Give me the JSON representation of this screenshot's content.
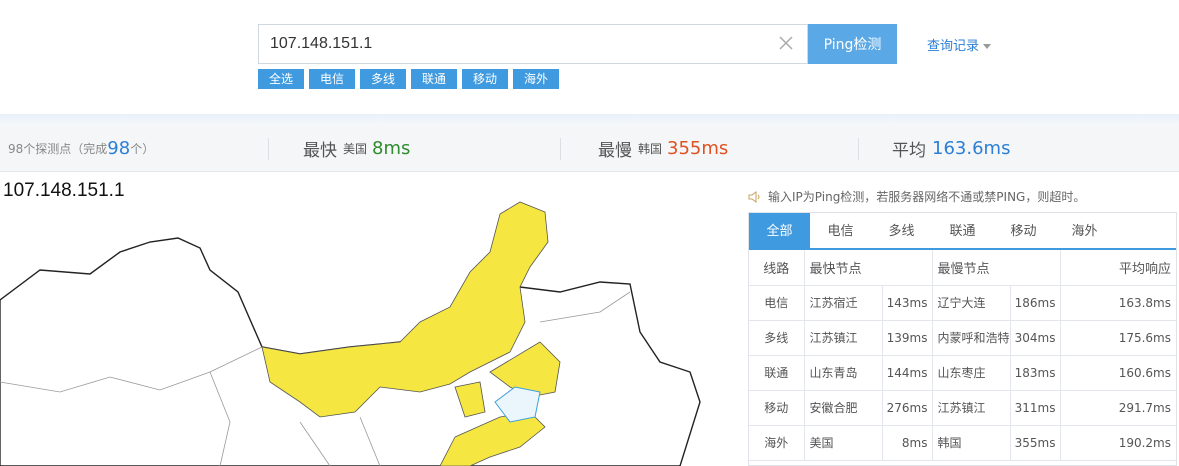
{
  "search": {
    "value": "107.148.151.1",
    "button_label": "Ping检测",
    "history_label": "查询记录",
    "filters": [
      "全选",
      "电信",
      "多线",
      "联通",
      "移动",
      "海外"
    ]
  },
  "stats": {
    "count_prefix": "98个探测点（完成",
    "count_value": "98",
    "count_suffix": "个）",
    "fastest_label": "最快",
    "fastest_country": "美国",
    "fastest_value": "8ms",
    "slowest_label": "最慢",
    "slowest_country": "韩国",
    "slowest_value": "355ms",
    "average_label": "平均",
    "average_value": "163.6ms"
  },
  "map": {
    "title": "107.148.151.1"
  },
  "notice": "输入IP为Ping检测，若服务器网络不通或禁PING，则超时。",
  "tabs": [
    "全部",
    "电信",
    "多线",
    "联通",
    "移动",
    "海外"
  ],
  "table": {
    "headers": {
      "line": "线路",
      "fastest": "最快节点",
      "slowest": "最慢节点",
      "average": "平均响应"
    },
    "rows": [
      {
        "line": "电信",
        "fast_node": "江苏宿迁",
        "fast_ms": "143ms",
        "slow_node": "辽宁大连",
        "slow_ms": "186ms",
        "avg": "163.8ms"
      },
      {
        "line": "多线",
        "fast_node": "江苏镇江",
        "fast_ms": "139ms",
        "slow_node": "内蒙呼和浩特",
        "slow_ms": "304ms",
        "avg": "175.6ms"
      },
      {
        "line": "联通",
        "fast_node": "山东青岛",
        "fast_ms": "144ms",
        "slow_node": "山东枣庄",
        "slow_ms": "183ms",
        "avg": "160.6ms"
      },
      {
        "line": "移动",
        "fast_node": "安徽合肥",
        "fast_ms": "276ms",
        "slow_node": "江苏镇江",
        "slow_ms": "311ms",
        "avg": "291.7ms"
      },
      {
        "line": "海外",
        "fast_node": "美国",
        "fast_ms": "8ms",
        "slow_node": "韩国",
        "slow_ms": "355ms",
        "avg": "190.2ms"
      }
    ]
  },
  "colors": {
    "accent": "#3f9ae0",
    "button": "#5aa8e6",
    "highlight_region": "#f5e642",
    "fast": "#2e8b2e",
    "slow": "#e0521f",
    "average": "#2b7fd4"
  }
}
